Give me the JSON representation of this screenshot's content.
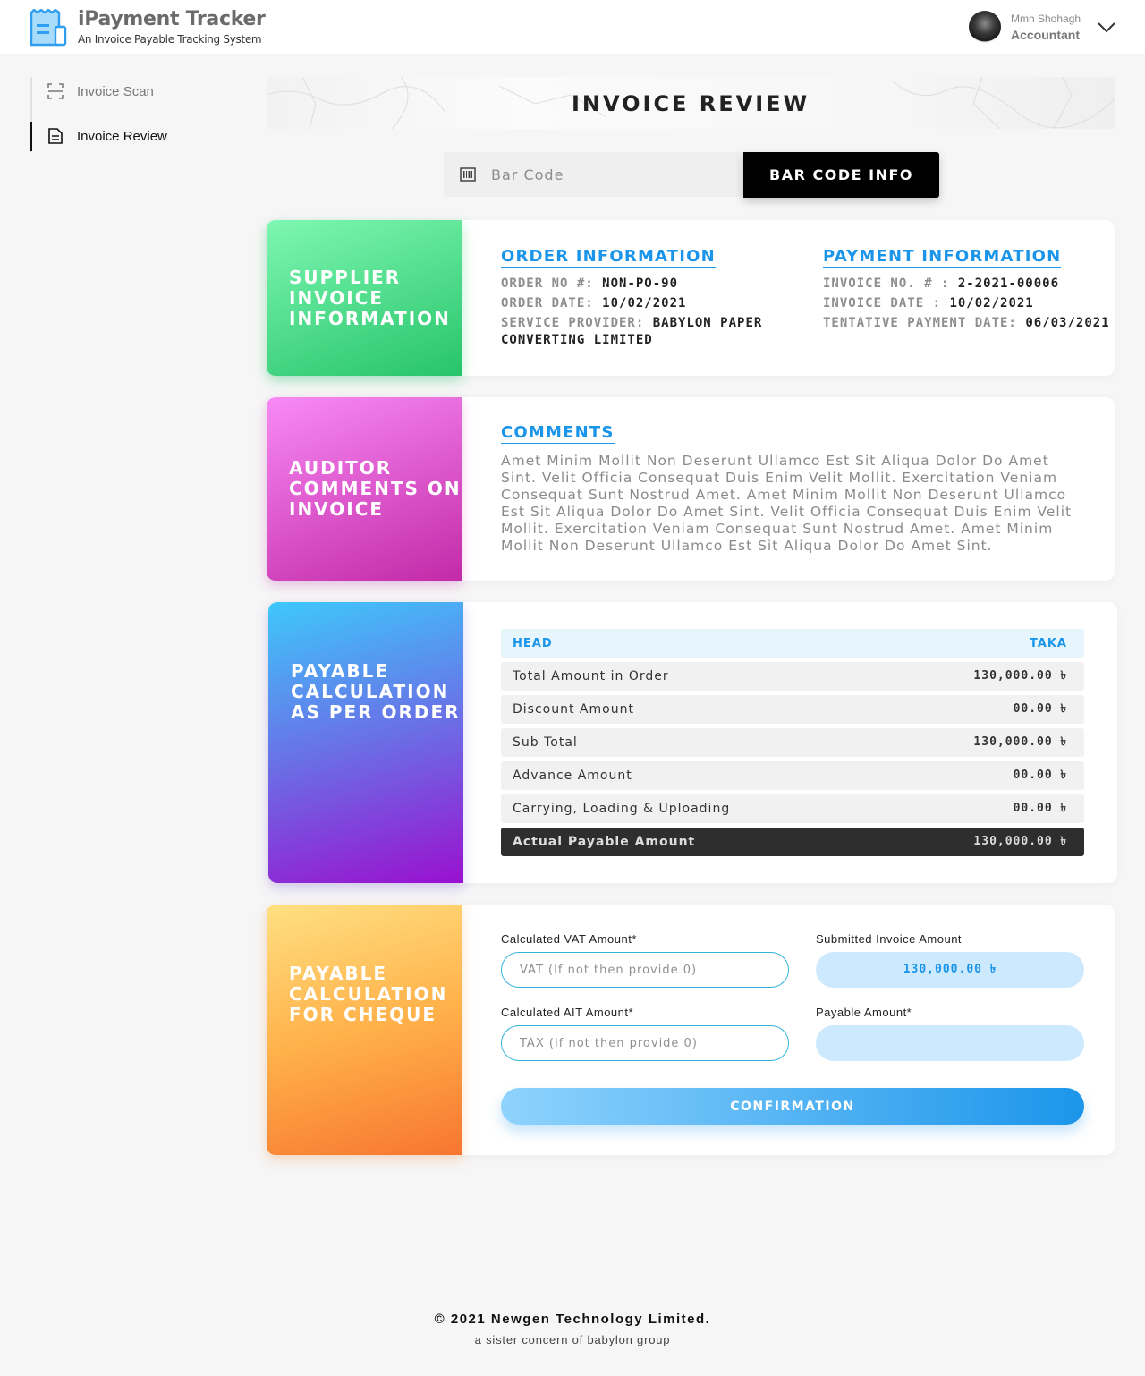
{
  "app": {
    "title": "iPayment Tracker",
    "subtitle": "An Invoice Payable Tracking System"
  },
  "user": {
    "name": "Mmh Shohagh",
    "role": "Accountant"
  },
  "sidebar": {
    "items": [
      {
        "label": "Invoice Scan",
        "icon": "scan-icon",
        "active": false
      },
      {
        "label": "Invoice Review",
        "icon": "document-icon",
        "active": true
      }
    ]
  },
  "page": {
    "title": "INVOICE REVIEW"
  },
  "barcode": {
    "placeholder": "Bar Code",
    "button_label": "BAR CODE INFO"
  },
  "supplier": {
    "panel_title": "SUPPLIER INVOICE INFORMATION",
    "order": {
      "title": "ORDER INFORMATION",
      "order_no_label": "ORDER NO #:",
      "order_no": "NON-PO-90",
      "order_date_label": "ORDER DATE:",
      "order_date": "10/02/2021",
      "provider_label": "SERVICE PROVIDER:",
      "provider": "BABYLON PAPER CONVERTING LIMITED"
    },
    "payment": {
      "title": "PAYMENT INFORMATION",
      "invoice_no_label": "INVOICE NO. # :",
      "invoice_no": "2-2021-00006",
      "invoice_date_label": "INVOICE DATE :",
      "invoice_date": "10/02/2021",
      "tentative_label": "TENTATIVE PAYMENT DATE:",
      "tentative_date": "06/03/2021"
    }
  },
  "auditor": {
    "panel_title": "AUDITOR COMMENTS ON INVOICE",
    "comments_title": "COMMENTS",
    "comments": "Amet Minim Mollit Non Deserunt Ullamco Est Sit Aliqua Dolor Do Amet Sint. Velit Officia Consequat Duis Enim Velit Mollit. Exercitation Veniam Consequat Sunt Nostrud Amet. Amet Minim Mollit Non Deserunt Ullamco Est Sit Aliqua Dolor Do Amet Sint. Velit Officia Consequat Duis Enim Velit Mollit. Exercitation Veniam Consequat Sunt Nostrud Amet. Amet Minim Mollit Non Deserunt Ullamco Est Sit Aliqua Dolor Do Amet Sint."
  },
  "order_calc": {
    "panel_title": "PAYABLE CALCULATION AS PER ORDER",
    "head_label": "HEAD",
    "taka_label": "TAKA",
    "rows": [
      {
        "label": "Total Amount in Order",
        "value": "130,000.00 ৳"
      },
      {
        "label": "Discount Amount",
        "value": "00.00 ৳"
      },
      {
        "label": "Sub Total",
        "value": "130,000.00 ৳"
      },
      {
        "label": "Advance Amount",
        "value": "00.00 ৳"
      },
      {
        "label": "Carrying, Loading & Uploading",
        "value": "00.00 ৳"
      }
    ],
    "total": {
      "label": "Actual Payable Amount",
      "value": "130,000.00 ৳"
    }
  },
  "cheque": {
    "panel_title": "PAYABLE CALCULATION FOR CHEQUE",
    "vat_label": "Calculated VAT Amount*",
    "vat_placeholder": "VAT (If not then provide 0)",
    "submitted_label": "Submitted Invoice Amount",
    "submitted_value": "130,000.00 ৳",
    "ait_label": "Calculated AIT Amount*",
    "ait_placeholder": "TAX (If not then provide 0)",
    "payable_label": "Payable Amount*",
    "payable_value": "",
    "confirm_label": "CONFIRMATION"
  },
  "footer": {
    "copyright": "© 2021 Newgen Technology Limited.",
    "tagline": "a sister concern of babylon group"
  },
  "colors": {
    "accent": "#1b95ea",
    "dark": "#2e2e2e"
  }
}
